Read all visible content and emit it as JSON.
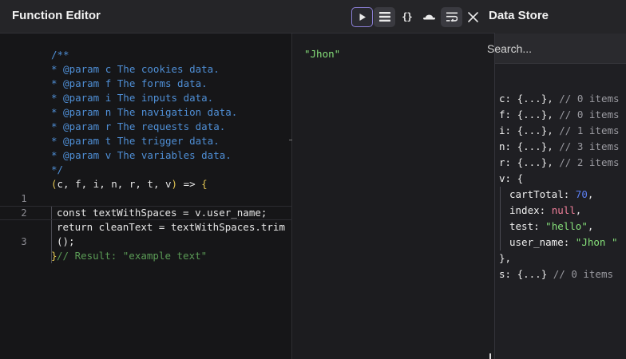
{
  "editor": {
    "title": "Function Editor",
    "toolbar": {
      "run_icon": "play-icon",
      "list_icon": "list-icon",
      "braces_label": "{}",
      "theme_icon": "hat-icon",
      "wrap_icon": "wrap-icon",
      "close_icon": "close-icon"
    },
    "code_lines": [
      {
        "ln": "",
        "text": "/**"
      },
      {
        "ln": "",
        "text": "* @param c The cookies data."
      },
      {
        "ln": "",
        "text": "* @param f The forms data."
      },
      {
        "ln": "",
        "text": "* @param i The inputs data."
      },
      {
        "ln": "",
        "text": "* @param n The navigation data."
      },
      {
        "ln": "",
        "text": "* @param r The requests data."
      },
      {
        "ln": "",
        "text": "* @param t The trigger data."
      },
      {
        "ln": "",
        "text": "* @param v The variables data."
      },
      {
        "ln": "",
        "text": "*/"
      },
      {
        "ln": "",
        "open_paren": "(",
        "params": "c, f, i, n, r, t, v",
        "close_paren": ")",
        "arrow": " => ",
        "brace": "{"
      },
      {
        "ln": "1",
        "text": "const textWithSpaces = v.user_name;"
      },
      {
        "ln": "2",
        "text": "return cleanText = textWithSpaces.trim"
      },
      {
        "ln": "",
        "text": "();"
      },
      {
        "ln": "3",
        "text": "// Result: \"example text\""
      },
      {
        "ln": "",
        "text": "}"
      }
    ],
    "output": "\"Jhon\""
  },
  "store": {
    "title": "Data Store",
    "search_placeholder": "Search...",
    "rows": [
      {
        "key": "c:",
        "val": " {...},",
        "comment": " // 0 items"
      },
      {
        "key": "f:",
        "val": " {...},",
        "comment": " // 0 items"
      },
      {
        "key": "i:",
        "val": " {...},",
        "comment": " // 1 items"
      },
      {
        "key": "n:",
        "val": " {...},",
        "comment": " // 3 items"
      },
      {
        "key": "r:",
        "val": " {...},",
        "comment": " // 2 items"
      }
    ],
    "v_key": "v:",
    "v_open": " {",
    "v_children": [
      {
        "key": "cartTotal:",
        "val": "70",
        "suffix": ","
      },
      {
        "key": "index:",
        "val": "null",
        "suffix": ","
      },
      {
        "key": "test:",
        "val": "\"hello\"",
        "suffix": ","
      },
      {
        "key": "user_name:",
        "val": "\"Jhon \"",
        "suffix": ""
      }
    ],
    "v_close": "},",
    "s_row": {
      "key": "s:",
      "val": " {...}",
      "comment": " // 0 items"
    }
  }
}
